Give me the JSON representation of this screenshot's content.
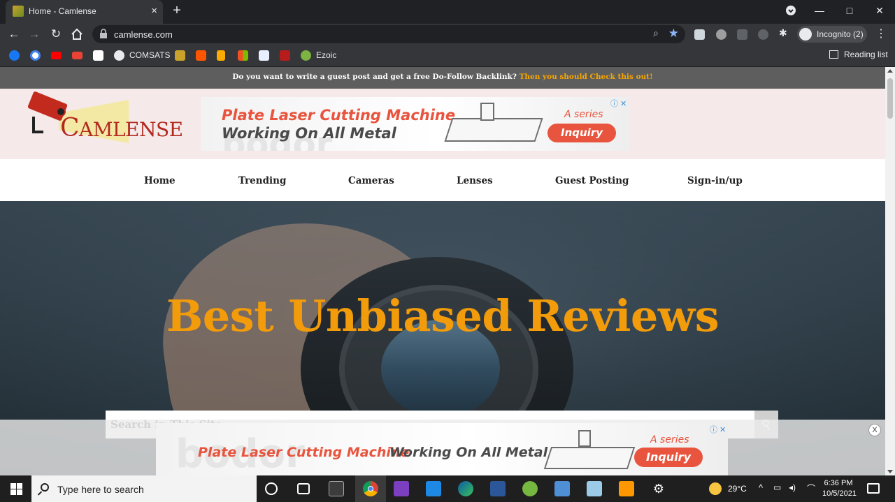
{
  "browser": {
    "tab_title": "Home - Camlense",
    "tab_close": "×",
    "new_tab": "+",
    "url": "camlense.com",
    "incognito_label": "Incognito (2)",
    "window_minimize": "—",
    "window_maximize": "□",
    "window_close": "✕"
  },
  "bookmarks": {
    "comsats": "COMSATS",
    "ezoic": "Ezoic",
    "reading_list": "Reading list"
  },
  "site": {
    "topbar_text": "Do you want to write a guest post and get a free Do-Follow Backlink?",
    "topbar_link": "Then you should Check this out!",
    "logo_text_first": "C",
    "logo_text_rest": "AMLENSE",
    "nav": [
      "Home",
      "Trending",
      "Cameras",
      "Lenses",
      "Guest Posting",
      "Sign-in/up"
    ],
    "hero_title": "Best Unbiased Reviews",
    "search_placeholder": "Search in This Site"
  },
  "ads": {
    "header_ad": {
      "line1": "Plate Laser Cutting Machine",
      "line2": "Working On All Metal",
      "series": "A series",
      "button": "Inquiry",
      "watermark": "bodor",
      "info": "ⓘ ✕"
    },
    "sticky_ad": {
      "line1": "Plate Laser Cutting Machine",
      "line2": "Working On All Metal",
      "series": "A series",
      "button": "Inquiry",
      "watermark": "bodor",
      "info": "ⓘ ✕"
    },
    "sticky_close": "X"
  },
  "taskbar": {
    "search_placeholder": "Type here to search",
    "temperature": "29°C",
    "time": "6:36 PM",
    "date": "10/5/2021"
  }
}
